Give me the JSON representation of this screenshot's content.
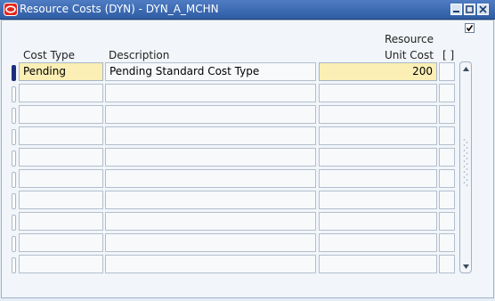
{
  "window": {
    "title": "Resource Costs (DYN) - DYN_A_MCHN",
    "colors": {
      "title_bar": "#3b68b2",
      "required_field": "#fbefb5",
      "record_indicator": "#1c2e7c"
    }
  },
  "columns": {
    "cost_type": "Cost Type",
    "description": "Description",
    "resource_unit_cost_line1": "Resource",
    "resource_unit_cost_line2": "Unit Cost",
    "flex_field": "[ ]"
  },
  "rows": [
    {
      "cost_type": "Pending",
      "description": "Pending Standard Cost Type",
      "unit_cost": "200"
    },
    {
      "cost_type": "",
      "description": "",
      "unit_cost": ""
    },
    {
      "cost_type": "",
      "description": "",
      "unit_cost": ""
    },
    {
      "cost_type": "",
      "description": "",
      "unit_cost": ""
    },
    {
      "cost_type": "",
      "description": "",
      "unit_cost": ""
    },
    {
      "cost_type": "",
      "description": "",
      "unit_cost": ""
    },
    {
      "cost_type": "",
      "description": "",
      "unit_cost": ""
    },
    {
      "cost_type": "",
      "description": "",
      "unit_cost": ""
    },
    {
      "cost_type": "",
      "description": "",
      "unit_cost": ""
    },
    {
      "cost_type": "",
      "description": "",
      "unit_cost": ""
    }
  ],
  "icons": {
    "app": "oracle-logo-icon",
    "minimize": "minimize-icon",
    "maximize": "maximize-icon",
    "close": "close-icon",
    "scroll_up": "scroll-up-arrow-icon",
    "scroll_down": "scroll-down-arrow-icon",
    "checkbox": "checkbox-checked-icon"
  }
}
